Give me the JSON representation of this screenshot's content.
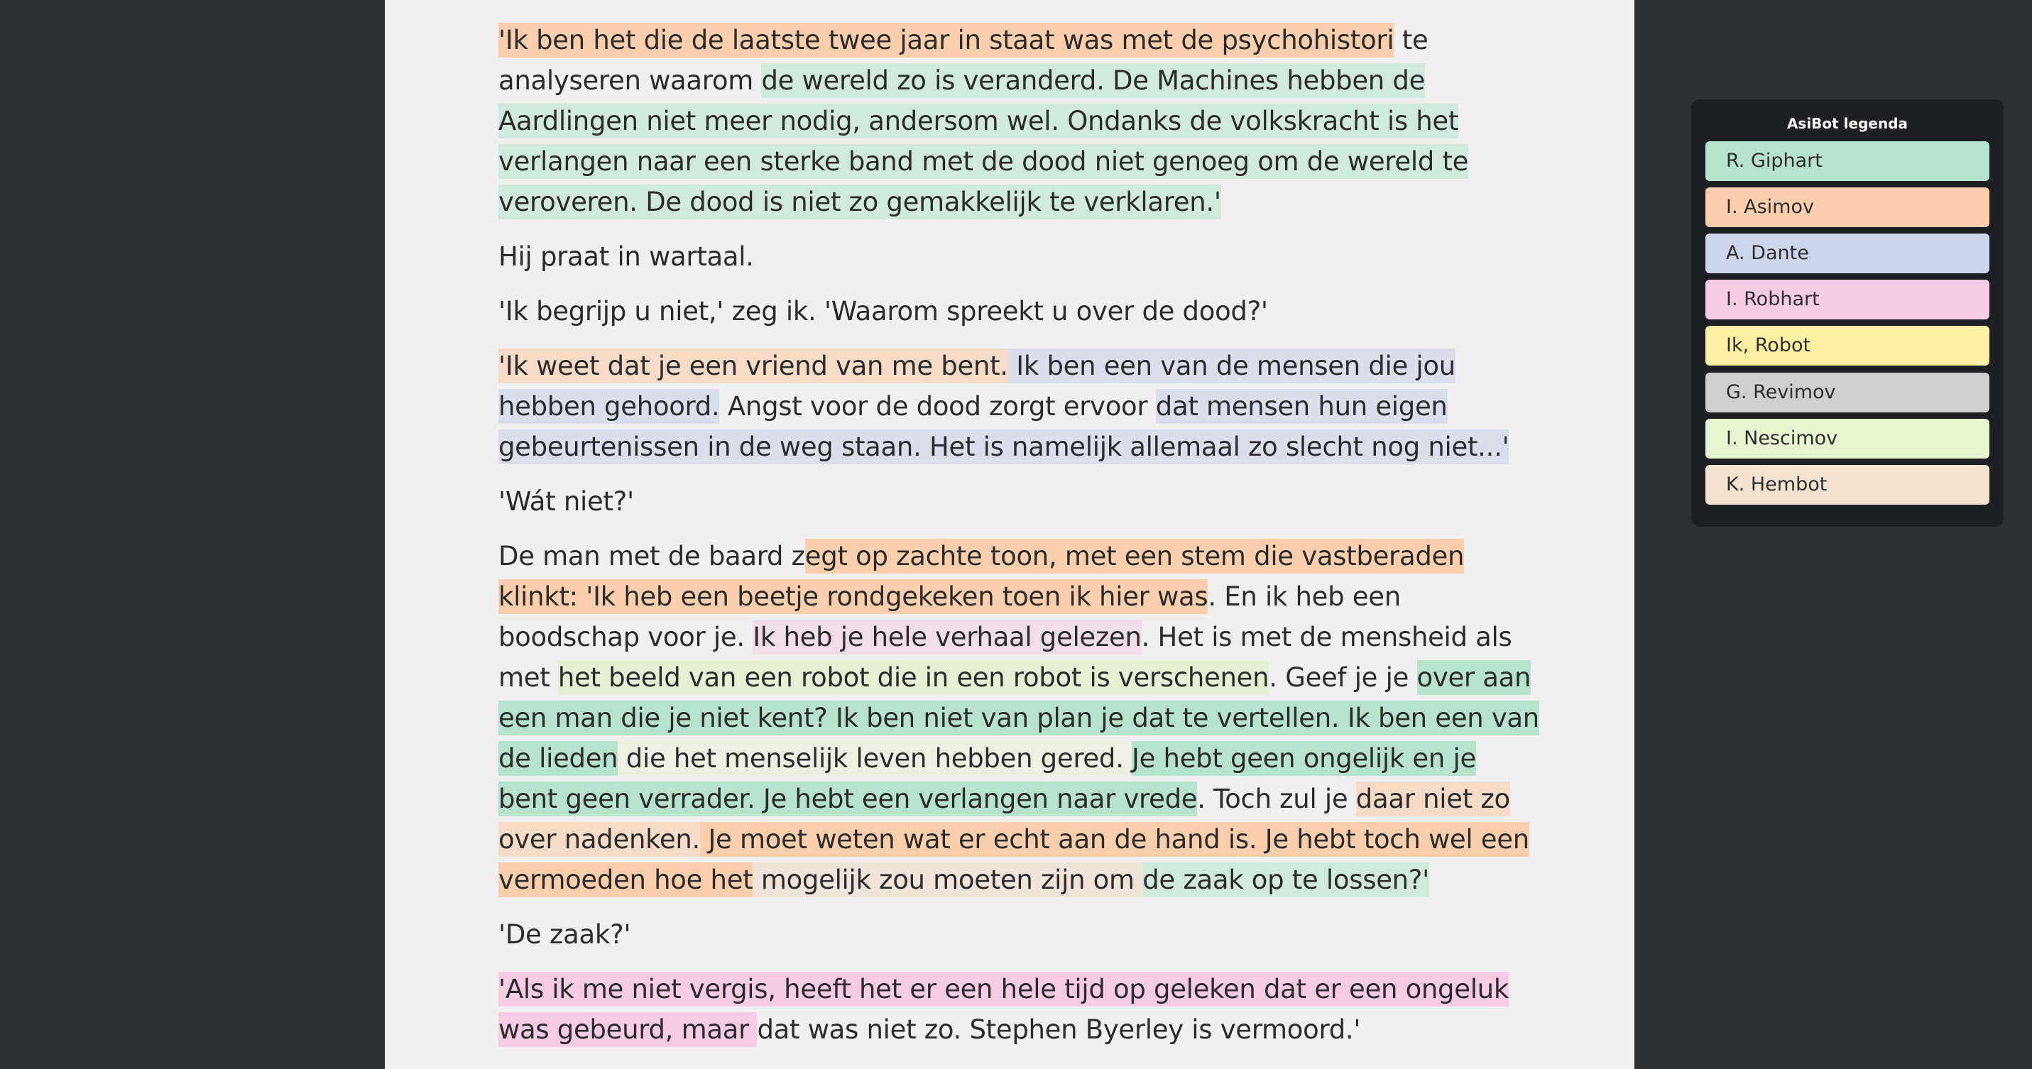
{
  "legend": {
    "title": "AsiBot legenda",
    "items": [
      {
        "label": "R. Giphart",
        "color": "#b5e3cc"
      },
      {
        "label": "I. Asimov",
        "color": "#fbcfac"
      },
      {
        "label": "A. Dante",
        "color": "#ccd6eb"
      },
      {
        "label": "I. Robhart",
        "color": "#f6cbe3"
      },
      {
        "label": "Ik, Robot",
        "color": "#fef0a3"
      },
      {
        "label": "G. Revimov",
        "color": "#cfcfcf"
      },
      {
        "label": "I. Nescimov",
        "color": "#e6f6cf"
      },
      {
        "label": "K. Hembot",
        "color": "#f2e2cf"
      }
    ]
  },
  "text": {
    "p1": [
      "'Ik ben het die de laatste twee jaar in staat was met de psychohistori",
      " te analyseren waarom ",
      "de wereld zo is veranderd. De Machines hebben de Aardlingen niet meer nodig, andersom wel. Ondanks de volkskracht is het verlangen naar een sterke band met de dood niet genoeg om de wereld te",
      " veroveren. De dood is niet zo gemakkelijk te verklaren.'"
    ],
    "p2": "Hij praat in wartaal.",
    "p3": "'Ik begrijp u niet,' zeg ik. 'Waarom spreekt u over de dood?'",
    "p4": [
      "'Ik weet dat je een vriend van me bent.",
      " Ik ben een van de mensen die jou hebben gehoord.",
      " Angst voor de dood zorgt ervoor ",
      "dat mensen hun eigen gebeurtenissen in de weg staan. Het is namelijk allemaal zo slecht nog niet...'"
    ],
    "p5": "'Wát niet?'",
    "p6": [
      "De man met de baard z",
      "egt op zachte toon, met een stem die vastberaden klinkt: 'Ik heb een beetje rondgekeken toen ik hier was",
      ". En ik heb een boodschap voor je. ",
      "Ik heb je hele verhaal gelezen",
      ". Het is met de mensheid als met ",
      "het beeld van een robot die in een robot is verschenen",
      ". Geef je je ",
      "over aan een man die je niet kent? Ik ben niet van plan je dat te vertellen. Ik ben een van de lieden",
      " die het menselijk leven hebben gered. ",
      "Je hebt geen ongelijk en je bent geen verrader. Je hebt een verlangen naar vrede",
      ". Toch zul je ",
      "daar niet zo over nadenken.",
      " Je moet weten wat er echt aan de hand is. Je hebt toch wel een vermoeden hoe het",
      " mogelijk zou moeten zijn om ",
      "de zaak op te lossen?'"
    ],
    "p7": "'De zaak?'",
    "p8": [
      "'Als ik me niet vergis, heeft het er een hele tijd op geleken dat er een ongeluk was gebeurd, maar ",
      "dat was niet zo. Stephen Byerley is vermoord.'"
    ]
  }
}
